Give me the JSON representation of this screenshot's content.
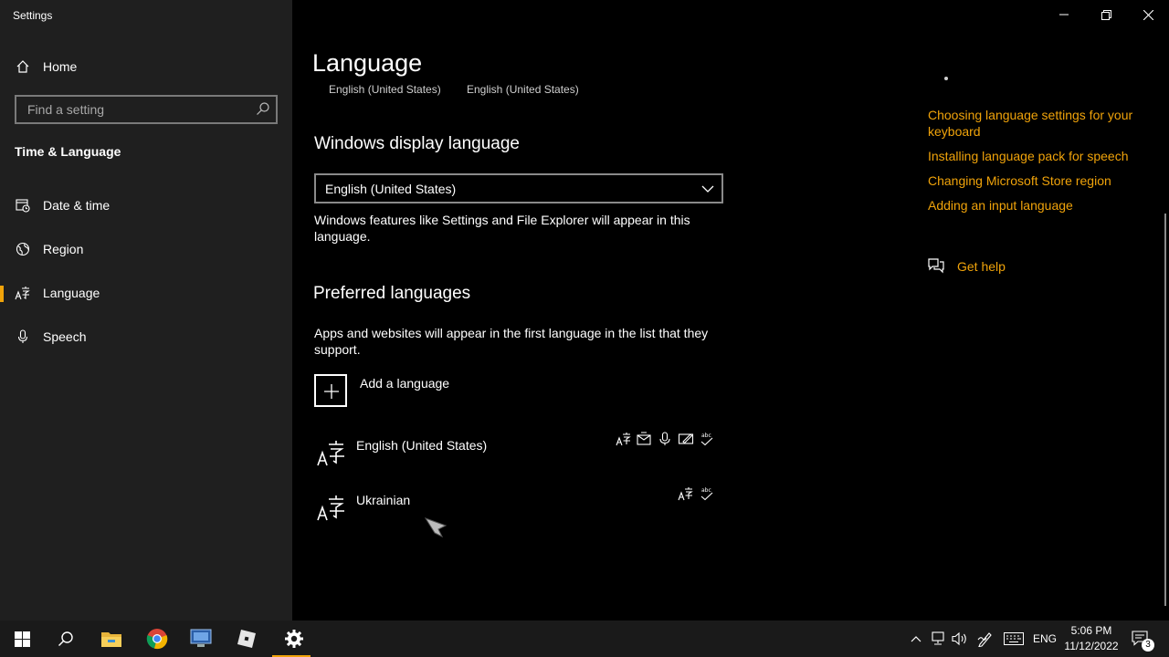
{
  "window": {
    "title": "Settings",
    "controls": [
      "minimize-icon",
      "restore-icon",
      "close-icon"
    ]
  },
  "sidebar": {
    "home_label": "Home",
    "search_placeholder": "Find a setting",
    "section_title": "Time & Language",
    "items": [
      {
        "label": "Date & time",
        "icon": "calendar-clock-icon"
      },
      {
        "label": "Region",
        "icon": "globe-icon"
      },
      {
        "label": "Language",
        "icon": "language-icon",
        "active": true
      },
      {
        "label": "Speech",
        "icon": "microphone-icon"
      }
    ]
  },
  "main": {
    "title": "Language",
    "cutoff_left": "English (United States)",
    "cutoff_right": "English (United States)",
    "display_language": {
      "heading": "Windows display language",
      "selected": "English (United States)",
      "description": "Windows features like Settings and File Explorer will appear in this language."
    },
    "preferred": {
      "heading": "Preferred languages",
      "description": "Apps and websites will appear in the first language in the list that they support.",
      "add_label": "Add a language",
      "languages": [
        {
          "name": "English (United States)",
          "features": [
            "display-language-icon",
            "text-to-speech-icon",
            "speech-recognition-icon",
            "handwriting-icon",
            "spellcheck-icon"
          ]
        },
        {
          "name": "Ukrainian",
          "features": [
            "display-language-icon",
            "spellcheck-icon"
          ]
        }
      ]
    }
  },
  "related": {
    "links": [
      "Choosing language settings for your keyboard",
      "Installing language pack for speech",
      "Changing Microsoft Store region",
      "Adding an input language"
    ],
    "get_help": "Get help"
  },
  "taskbar": {
    "apps": [
      "windows-start-icon",
      "search-icon",
      "file-explorer-icon",
      "chrome-icon",
      "remote-desktop-icon",
      "roblox-icon",
      "settings-gear-icon"
    ],
    "input_language": "ENG",
    "time": "5:06 PM",
    "date": "11/12/2022",
    "notifications_count": "3"
  },
  "colors": {
    "accent": "#f0a30a",
    "sidebar_bg": "#1f1f1f",
    "main_bg": "#000000",
    "taskbar_bg": "#1a1a1a"
  }
}
